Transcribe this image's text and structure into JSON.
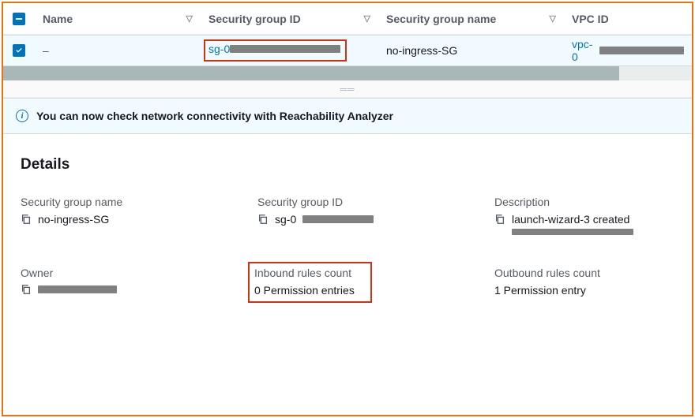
{
  "table": {
    "headers": {
      "name": "Name",
      "sg_id": "Security group ID",
      "sg_name": "Security group name",
      "vpc_id": "VPC ID"
    },
    "row": {
      "name": "–",
      "sg_id_prefix": "sg-0",
      "sg_name": "no-ingress-SG",
      "vpc_prefix": "vpc-0"
    }
  },
  "banner": {
    "text": "You can now check network connectivity with Reachability Analyzer"
  },
  "details": {
    "title": "Details",
    "fields": {
      "sg_name_label": "Security group name",
      "sg_name_value": "no-ingress-SG",
      "sg_id_label": "Security group ID",
      "sg_id_value_prefix": "sg-0",
      "description_label": "Description",
      "description_value": "launch-wizard-3 created",
      "owner_label": "Owner",
      "inbound_label": "Inbound rules count",
      "inbound_value": "0 Permission entries",
      "outbound_label": "Outbound rules count",
      "outbound_value": "1 Permission entry"
    }
  }
}
